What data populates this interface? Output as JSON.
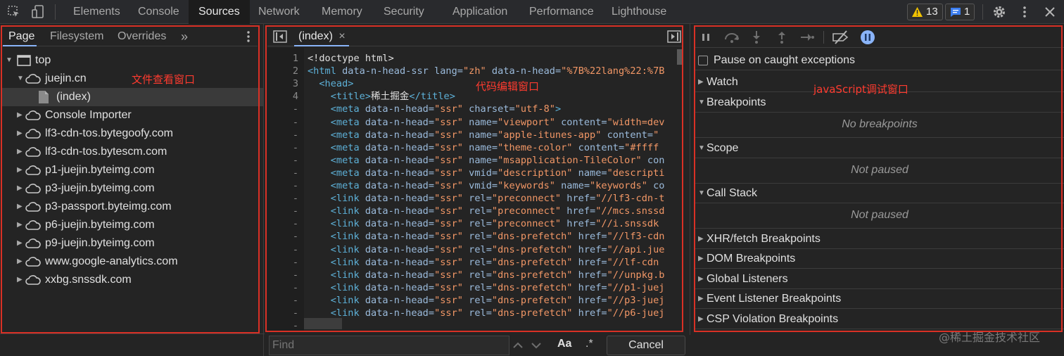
{
  "toolbar": {
    "tabs": [
      "Elements",
      "Console",
      "Sources",
      "Network",
      "Memory",
      "Security",
      "Application",
      "Performance",
      "Lighthouse"
    ],
    "warnings_count": "13",
    "messages_count": "1"
  },
  "navigator": {
    "tabs": [
      "Page",
      "Filesystem",
      "Overrides"
    ],
    "more": "»",
    "tree": [
      {
        "label": "top"
      },
      {
        "label": "juejin.cn"
      },
      {
        "label": "(index)"
      },
      {
        "label": "Console Importer"
      },
      {
        "label": "lf3-cdn-tos.bytegoofy.com"
      },
      {
        "label": "lf3-cdn-tos.bytescm.com"
      },
      {
        "label": "p1-juejin.byteimg.com"
      },
      {
        "label": "p3-juejin.byteimg.com"
      },
      {
        "label": "p3-passport.byteimg.com"
      },
      {
        "label": "p6-juejin.byteimg.com"
      },
      {
        "label": "p9-juejin.byteimg.com"
      },
      {
        "label": "www.google-analytics.com"
      },
      {
        "label": "xxbg.snssdk.com"
      }
    ],
    "annotation": "文件查看窗口"
  },
  "editor": {
    "tab_label": "(index)",
    "close": "×",
    "annotation": "代码编辑窗口",
    "lines": [
      {
        "n": "1",
        "parts": [
          [
            "txt",
            "<!doctype html>"
          ]
        ]
      },
      {
        "n": "2",
        "parts": [
          [
            "tag",
            "<html "
          ],
          [
            "attr",
            "data-n-head-ssr lang="
          ],
          [
            "val",
            "\"zh\""
          ],
          [
            "attr",
            " data-n-head="
          ],
          [
            "val",
            "\"%7B%22lang%22:%7B"
          ]
        ]
      },
      {
        "n": "3",
        "parts": [
          [
            "tag",
            "  <head>"
          ]
        ]
      },
      {
        "n": "4",
        "parts": [
          [
            "tag",
            "    <title>"
          ],
          [
            "txt",
            "稀土掘金"
          ],
          [
            "tag",
            "</title>"
          ]
        ]
      },
      {
        "n": "-",
        "parts": [
          [
            "tag",
            "    <meta "
          ],
          [
            "attr",
            "data-n-head="
          ],
          [
            "val",
            "\"ssr\""
          ],
          [
            "attr",
            " charset="
          ],
          [
            "val",
            "\"utf-8\""
          ],
          [
            "tag",
            ">"
          ]
        ]
      },
      {
        "n": "-",
        "parts": [
          [
            "tag",
            "    <meta "
          ],
          [
            "attr",
            "data-n-head="
          ],
          [
            "val",
            "\"ssr\""
          ],
          [
            "attr",
            " name="
          ],
          [
            "val",
            "\"viewport\""
          ],
          [
            "attr",
            " content="
          ],
          [
            "val",
            "\"width=dev"
          ]
        ]
      },
      {
        "n": "-",
        "parts": [
          [
            "tag",
            "    <meta "
          ],
          [
            "attr",
            "data-n-head="
          ],
          [
            "val",
            "\"ssr\""
          ],
          [
            "attr",
            " name="
          ],
          [
            "val",
            "\"apple-itunes-app\""
          ],
          [
            "attr",
            " content="
          ],
          [
            "val",
            "\""
          ]
        ]
      },
      {
        "n": "-",
        "parts": [
          [
            "tag",
            "    <meta "
          ],
          [
            "attr",
            "data-n-head="
          ],
          [
            "val",
            "\"ssr\""
          ],
          [
            "attr",
            " name="
          ],
          [
            "val",
            "\"theme-color\""
          ],
          [
            "attr",
            " content="
          ],
          [
            "val",
            "\"#ffff"
          ]
        ]
      },
      {
        "n": "-",
        "parts": [
          [
            "tag",
            "    <meta "
          ],
          [
            "attr",
            "data-n-head="
          ],
          [
            "val",
            "\"ssr\""
          ],
          [
            "attr",
            " name="
          ],
          [
            "val",
            "\"msapplication-TileColor\""
          ],
          [
            "attr",
            " con"
          ]
        ]
      },
      {
        "n": "-",
        "parts": [
          [
            "tag",
            "    <meta "
          ],
          [
            "attr",
            "data-n-head="
          ],
          [
            "val",
            "\"ssr\""
          ],
          [
            "attr",
            " vmid="
          ],
          [
            "val",
            "\"description\""
          ],
          [
            "attr",
            " name="
          ],
          [
            "val",
            "\"descripti"
          ]
        ]
      },
      {
        "n": "-",
        "parts": [
          [
            "tag",
            "    <meta "
          ],
          [
            "attr",
            "data-n-head="
          ],
          [
            "val",
            "\"ssr\""
          ],
          [
            "attr",
            " vmid="
          ],
          [
            "val",
            "\"keywords\""
          ],
          [
            "attr",
            " name="
          ],
          [
            "val",
            "\"keywords\""
          ],
          [
            "attr",
            " co"
          ]
        ]
      },
      {
        "n": "-",
        "parts": [
          [
            "tag",
            "    <link "
          ],
          [
            "attr",
            "data-n-head="
          ],
          [
            "val",
            "\"ssr\""
          ],
          [
            "attr",
            " rel="
          ],
          [
            "val",
            "\"preconnect\""
          ],
          [
            "attr",
            " href="
          ],
          [
            "val",
            "\"//lf3-cdn-t"
          ]
        ]
      },
      {
        "n": "-",
        "parts": [
          [
            "tag",
            "    <link "
          ],
          [
            "attr",
            "data-n-head="
          ],
          [
            "val",
            "\"ssr\""
          ],
          [
            "attr",
            " rel="
          ],
          [
            "val",
            "\"preconnect\""
          ],
          [
            "attr",
            " href="
          ],
          [
            "val",
            "\"//mcs.snssd"
          ]
        ]
      },
      {
        "n": "-",
        "parts": [
          [
            "tag",
            "    <link "
          ],
          [
            "attr",
            "data-n-head="
          ],
          [
            "val",
            "\"ssr\""
          ],
          [
            "attr",
            " rel="
          ],
          [
            "val",
            "\"preconnect\""
          ],
          [
            "attr",
            " href="
          ],
          [
            "val",
            "\"//i.snssdk"
          ]
        ]
      },
      {
        "n": "-",
        "parts": [
          [
            "tag",
            "    <link "
          ],
          [
            "attr",
            "data-n-head="
          ],
          [
            "val",
            "\"ssr\""
          ],
          [
            "attr",
            " rel="
          ],
          [
            "val",
            "\"dns-prefetch\""
          ],
          [
            "attr",
            " href="
          ],
          [
            "val",
            "\"//lf3-cdn"
          ]
        ]
      },
      {
        "n": "-",
        "parts": [
          [
            "tag",
            "    <link "
          ],
          [
            "attr",
            "data-n-head="
          ],
          [
            "val",
            "\"ssr\""
          ],
          [
            "attr",
            " rel="
          ],
          [
            "val",
            "\"dns-prefetch\""
          ],
          [
            "attr",
            " href="
          ],
          [
            "val",
            "\"//api.jue"
          ]
        ]
      },
      {
        "n": "-",
        "parts": [
          [
            "tag",
            "    <link "
          ],
          [
            "attr",
            "data-n-head="
          ],
          [
            "val",
            "\"ssr\""
          ],
          [
            "attr",
            " rel="
          ],
          [
            "val",
            "\"dns-prefetch\""
          ],
          [
            "attr",
            " href="
          ],
          [
            "val",
            "\"//lf-cdn"
          ]
        ]
      },
      {
        "n": "-",
        "parts": [
          [
            "tag",
            "    <link "
          ],
          [
            "attr",
            "data-n-head="
          ],
          [
            "val",
            "\"ssr\""
          ],
          [
            "attr",
            " rel="
          ],
          [
            "val",
            "\"dns-prefetch\""
          ],
          [
            "attr",
            " href="
          ],
          [
            "val",
            "\"//unpkg.b"
          ]
        ]
      },
      {
        "n": "-",
        "parts": [
          [
            "tag",
            "    <link "
          ],
          [
            "attr",
            "data-n-head="
          ],
          [
            "val",
            "\"ssr\""
          ],
          [
            "attr",
            " rel="
          ],
          [
            "val",
            "\"dns-prefetch\""
          ],
          [
            "attr",
            " href="
          ],
          [
            "val",
            "\"//p1-juej"
          ]
        ]
      },
      {
        "n": "-",
        "parts": [
          [
            "tag",
            "    <link "
          ],
          [
            "attr",
            "data-n-head="
          ],
          [
            "val",
            "\"ssr\""
          ],
          [
            "attr",
            " rel="
          ],
          [
            "val",
            "\"dns-prefetch\""
          ],
          [
            "attr",
            " href="
          ],
          [
            "val",
            "\"//p3-juej"
          ]
        ]
      },
      {
        "n": "-",
        "parts": [
          [
            "tag",
            "    <link "
          ],
          [
            "attr",
            "data-n-head="
          ],
          [
            "val",
            "\"ssr\""
          ],
          [
            "attr",
            " rel="
          ],
          [
            "val",
            "\"dns-prefetch\""
          ],
          [
            "attr",
            " href="
          ],
          [
            "val",
            "\"//p6-juej"
          ]
        ]
      },
      {
        "n": "-",
        "parts": []
      }
    ]
  },
  "find": {
    "placeholder": "Find",
    "match_case": "Aa",
    "regex": ".*",
    "cancel": "Cancel"
  },
  "debugger": {
    "pause_caught_label": "Pause on caught exceptions",
    "annotation": "javaScript调试窗口",
    "sections": {
      "watch": "Watch",
      "breakpoints": "Breakpoints",
      "no_breakpoints": "No breakpoints",
      "scope": "Scope",
      "scope_status": "Not paused",
      "call_stack": "Call Stack",
      "call_stack_status": "Not paused",
      "xhr": "XHR/fetch Breakpoints",
      "dom": "DOM Breakpoints",
      "global": "Global Listeners",
      "event": "Event Listener Breakpoints",
      "csp": "CSP Violation Breakpoints"
    }
  },
  "watermark": "@稀土掘金技术社区",
  "colors": {
    "annotation_red": "#d93025",
    "active_blue": "#8ab4f8",
    "warning_yellow": "#f2c300"
  }
}
